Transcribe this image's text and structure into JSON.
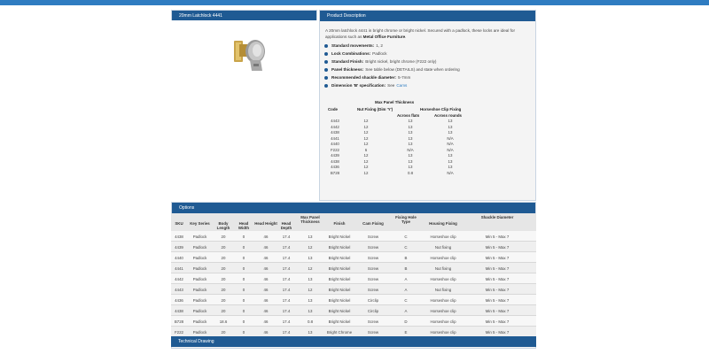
{
  "top_panel_title": "20mm Latchlock 4441",
  "description_panel": {
    "title": "Product Description",
    "text_plain": "A 20mm latchlock 4441 in bright chrome or bright nickel. Secured with a padlock, these locks are ideal for applications such as",
    "text_bold": "Metal Office Furniture",
    "text_end": "."
  },
  "features": [
    {
      "label": "Standard movements:",
      "value": "1, 2"
    },
    {
      "label": "Lock Combinations:",
      "value": "Padlock"
    },
    {
      "label": "Standard Finish:",
      "value": "Bright nickel, bright chrome (F222 only)"
    },
    {
      "label": "Panel thickness:",
      "value": "See table below (DETAILS) and state when ordering"
    },
    {
      "label": "Recommended shackle diameter:",
      "value": "5-7mm"
    },
    {
      "label": "Dimension 'B' specification:",
      "value": "See",
      "link": "Cams"
    }
  ],
  "thickness_table": {
    "header_max": "Max Panel Thickness",
    "header_code": "Code",
    "header_nut": "Nut Fixing (Dim 'Y')",
    "header_horseshoe": "Horseshoe Clip Fixing",
    "header_flats": "Across flats",
    "header_rounds": "Across rounds",
    "rows": [
      {
        "code": "4443",
        "nut": "12",
        "flats": "13",
        "rounds": "13"
      },
      {
        "code": "4442",
        "nut": "12",
        "flats": "13",
        "rounds": "13"
      },
      {
        "code": "4438",
        "nut": "12",
        "flats": "13",
        "rounds": "13"
      },
      {
        "code": "4441",
        "nut": "12",
        "flats": "13",
        "rounds": "N/A"
      },
      {
        "code": "4440",
        "nut": "12",
        "flats": "13",
        "rounds": "N/A"
      },
      {
        "code": "F222",
        "nut": "6",
        "flats": "N/A",
        "rounds": "N/A"
      },
      {
        "code": "4439",
        "nut": "12",
        "flats": "13",
        "rounds": "13"
      },
      {
        "code": "4438",
        "nut": "12",
        "flats": "13",
        "rounds": "13"
      },
      {
        "code": "4436",
        "nut": "12",
        "flats": "13",
        "rounds": "13"
      },
      {
        "code": "B728",
        "nut": "12",
        "flats": "0.8",
        "rounds": "N/A"
      }
    ]
  },
  "options_panel": {
    "title": "Options",
    "headers": [
      "SKU",
      "Key Series",
      "Body Length",
      "Head Width",
      "Head Height",
      "Head Depth",
      "Max Panel Thickness",
      "Finish",
      "Cam Fixing",
      "Fixing Hole Type",
      "Housing Fixing",
      "Shackle Diameter"
    ],
    "rows": [
      [
        "4438",
        "Padlock",
        "20",
        "0",
        "46",
        "17.4",
        "13",
        "Bright Nickel",
        "Screw",
        "C",
        "Horseshoe clip",
        "Min 5 - Max 7"
      ],
      [
        "4439",
        "Padlock",
        "20",
        "0",
        "46",
        "17.4",
        "12",
        "Bright Nickel",
        "Screw",
        "C",
        "Nut fixing",
        "Min 5 - Max 7"
      ],
      [
        "4440",
        "Padlock",
        "20",
        "0",
        "46",
        "17.4",
        "13",
        "Bright Nickel",
        "Screw",
        "B",
        "Horseshoe clip",
        "Min 5 - Max 7"
      ],
      [
        "4441",
        "Padlock",
        "20",
        "0",
        "46",
        "17.4",
        "12",
        "Bright Nickel",
        "Screw",
        "B",
        "Nut fixing",
        "Min 5 - Max 7"
      ],
      [
        "4442",
        "Padlock",
        "20",
        "0",
        "46",
        "17.4",
        "13",
        "Bright Nickel",
        "Screw",
        "A",
        "Horseshoe clip",
        "Min 5 - Max 7"
      ],
      [
        "4443",
        "Padlock",
        "20",
        "0",
        "46",
        "17.4",
        "12",
        "Bright Nickel",
        "Screw",
        "A",
        "Nut fixing",
        "Min 5 - Max 7"
      ],
      [
        "4436",
        "Padlock",
        "20",
        "0",
        "46",
        "17.4",
        "13",
        "Bright Nickel",
        "Circlip",
        "C",
        "Horseshoe clip",
        "Min 5 - Max 7"
      ],
      [
        "4438",
        "Padlock",
        "20",
        "0",
        "46",
        "17.4",
        "13",
        "Bright Nickel",
        "Circlip",
        "A",
        "Horseshoe clip",
        "Min 5 - Max 7"
      ],
      [
        "B728",
        "Padlock",
        "18.6",
        "0",
        "46",
        "17.4",
        "0.8",
        "Bright Nickel",
        "Screw",
        "D",
        "Horseshoe clip",
        "Min 5 - Max 7"
      ],
      [
        "F222",
        "Padlock",
        "20",
        "0",
        "46",
        "17.4",
        "13",
        "Bright Chrome",
        "Screw",
        "E",
        "Horseshoe clip",
        "Min 5 - Max 7"
      ]
    ]
  },
  "technical_drawing": {
    "title": "Technical Drawing"
  },
  "colors": {
    "header_blue": "#1f5a93",
    "accent_blue": "#2f7cc1",
    "panel_bg": "#f4f4f4"
  },
  "icons": {
    "bullet": "filled-circle-bullet",
    "product": "latchlock-product-image"
  }
}
